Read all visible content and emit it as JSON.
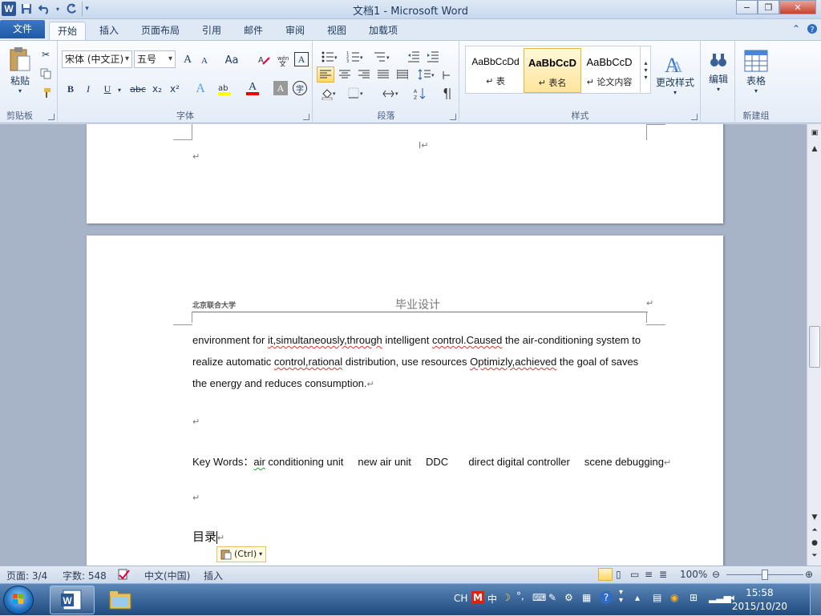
{
  "window": {
    "title": "文档1 - Microsoft Word",
    "minimize": "−",
    "maximize": "❐",
    "close": "✕"
  },
  "qat": {
    "word_icon": "W",
    "save_icon": "save-icon",
    "undo_icon": "undo-icon",
    "redo_icon": "redo-icon"
  },
  "tabs": {
    "file": "文件",
    "home": "开始",
    "insert": "插入",
    "page_layout": "页面布局",
    "references": "引用",
    "mailings": "邮件",
    "review": "审阅",
    "view": "视图",
    "addins": "加载项"
  },
  "clipboard": {
    "paste": "粘贴",
    "label": "剪贴板"
  },
  "font": {
    "name": "宋体 (中文正)",
    "size": "五号",
    "label": "字体",
    "grow": "A",
    "shrink": "A",
    "case": "Aa",
    "bold": "B",
    "italic": "I",
    "underline": "U",
    "strike": "abc",
    "subscript": "x₂",
    "superscript": "x²",
    "font_color": "A",
    "char_shading": "A"
  },
  "paragraph": {
    "label": "段落"
  },
  "styles": {
    "label": "样式",
    "items": [
      {
        "sample": "AaBbCcDd",
        "name": "↵ 表"
      },
      {
        "sample": "AaBbCcD",
        "name": "↵ 表名"
      },
      {
        "sample": "AaBbCcD",
        "name": "↵ 论文内容"
      }
    ],
    "change": "更改样式"
  },
  "editing": {
    "label": "编辑"
  },
  "newgroup": {
    "table": "表格",
    "label": "新建组"
  },
  "document": {
    "header_left": "北京联合大学",
    "header_center": "毕业设计",
    "para_line1": {
      "a": "environment for ",
      "b": "it,simultaneously,through",
      "c": " intelligent ",
      "d": "control.Caused",
      "e": " the air-conditioning  system to"
    },
    "para_line2": {
      "a": "realize automatic ",
      "b": "control,rational",
      "c": " distribution, use resources ",
      "d": "Optimizly,achieved",
      "e": " the goal of saves"
    },
    "para_line3": "the energy and reduces consumption.",
    "keywords_label": "Key Words：",
    "keywords_air": "air",
    "keywords_rest": " conditioning unit     new air unit     DDC       direct digital controller     scene debugging",
    "toc_title": "目录",
    "paste_options": "(Ctrl)"
  },
  "status": {
    "page": "页面: 3/4",
    "words": "字数: 548",
    "language": "中文(中国)",
    "mode": "插入",
    "zoom": "100%"
  },
  "taskbar": {
    "ime": "CH",
    "ime_cn": "中",
    "time": "15:58",
    "date": "2015/10/20"
  }
}
